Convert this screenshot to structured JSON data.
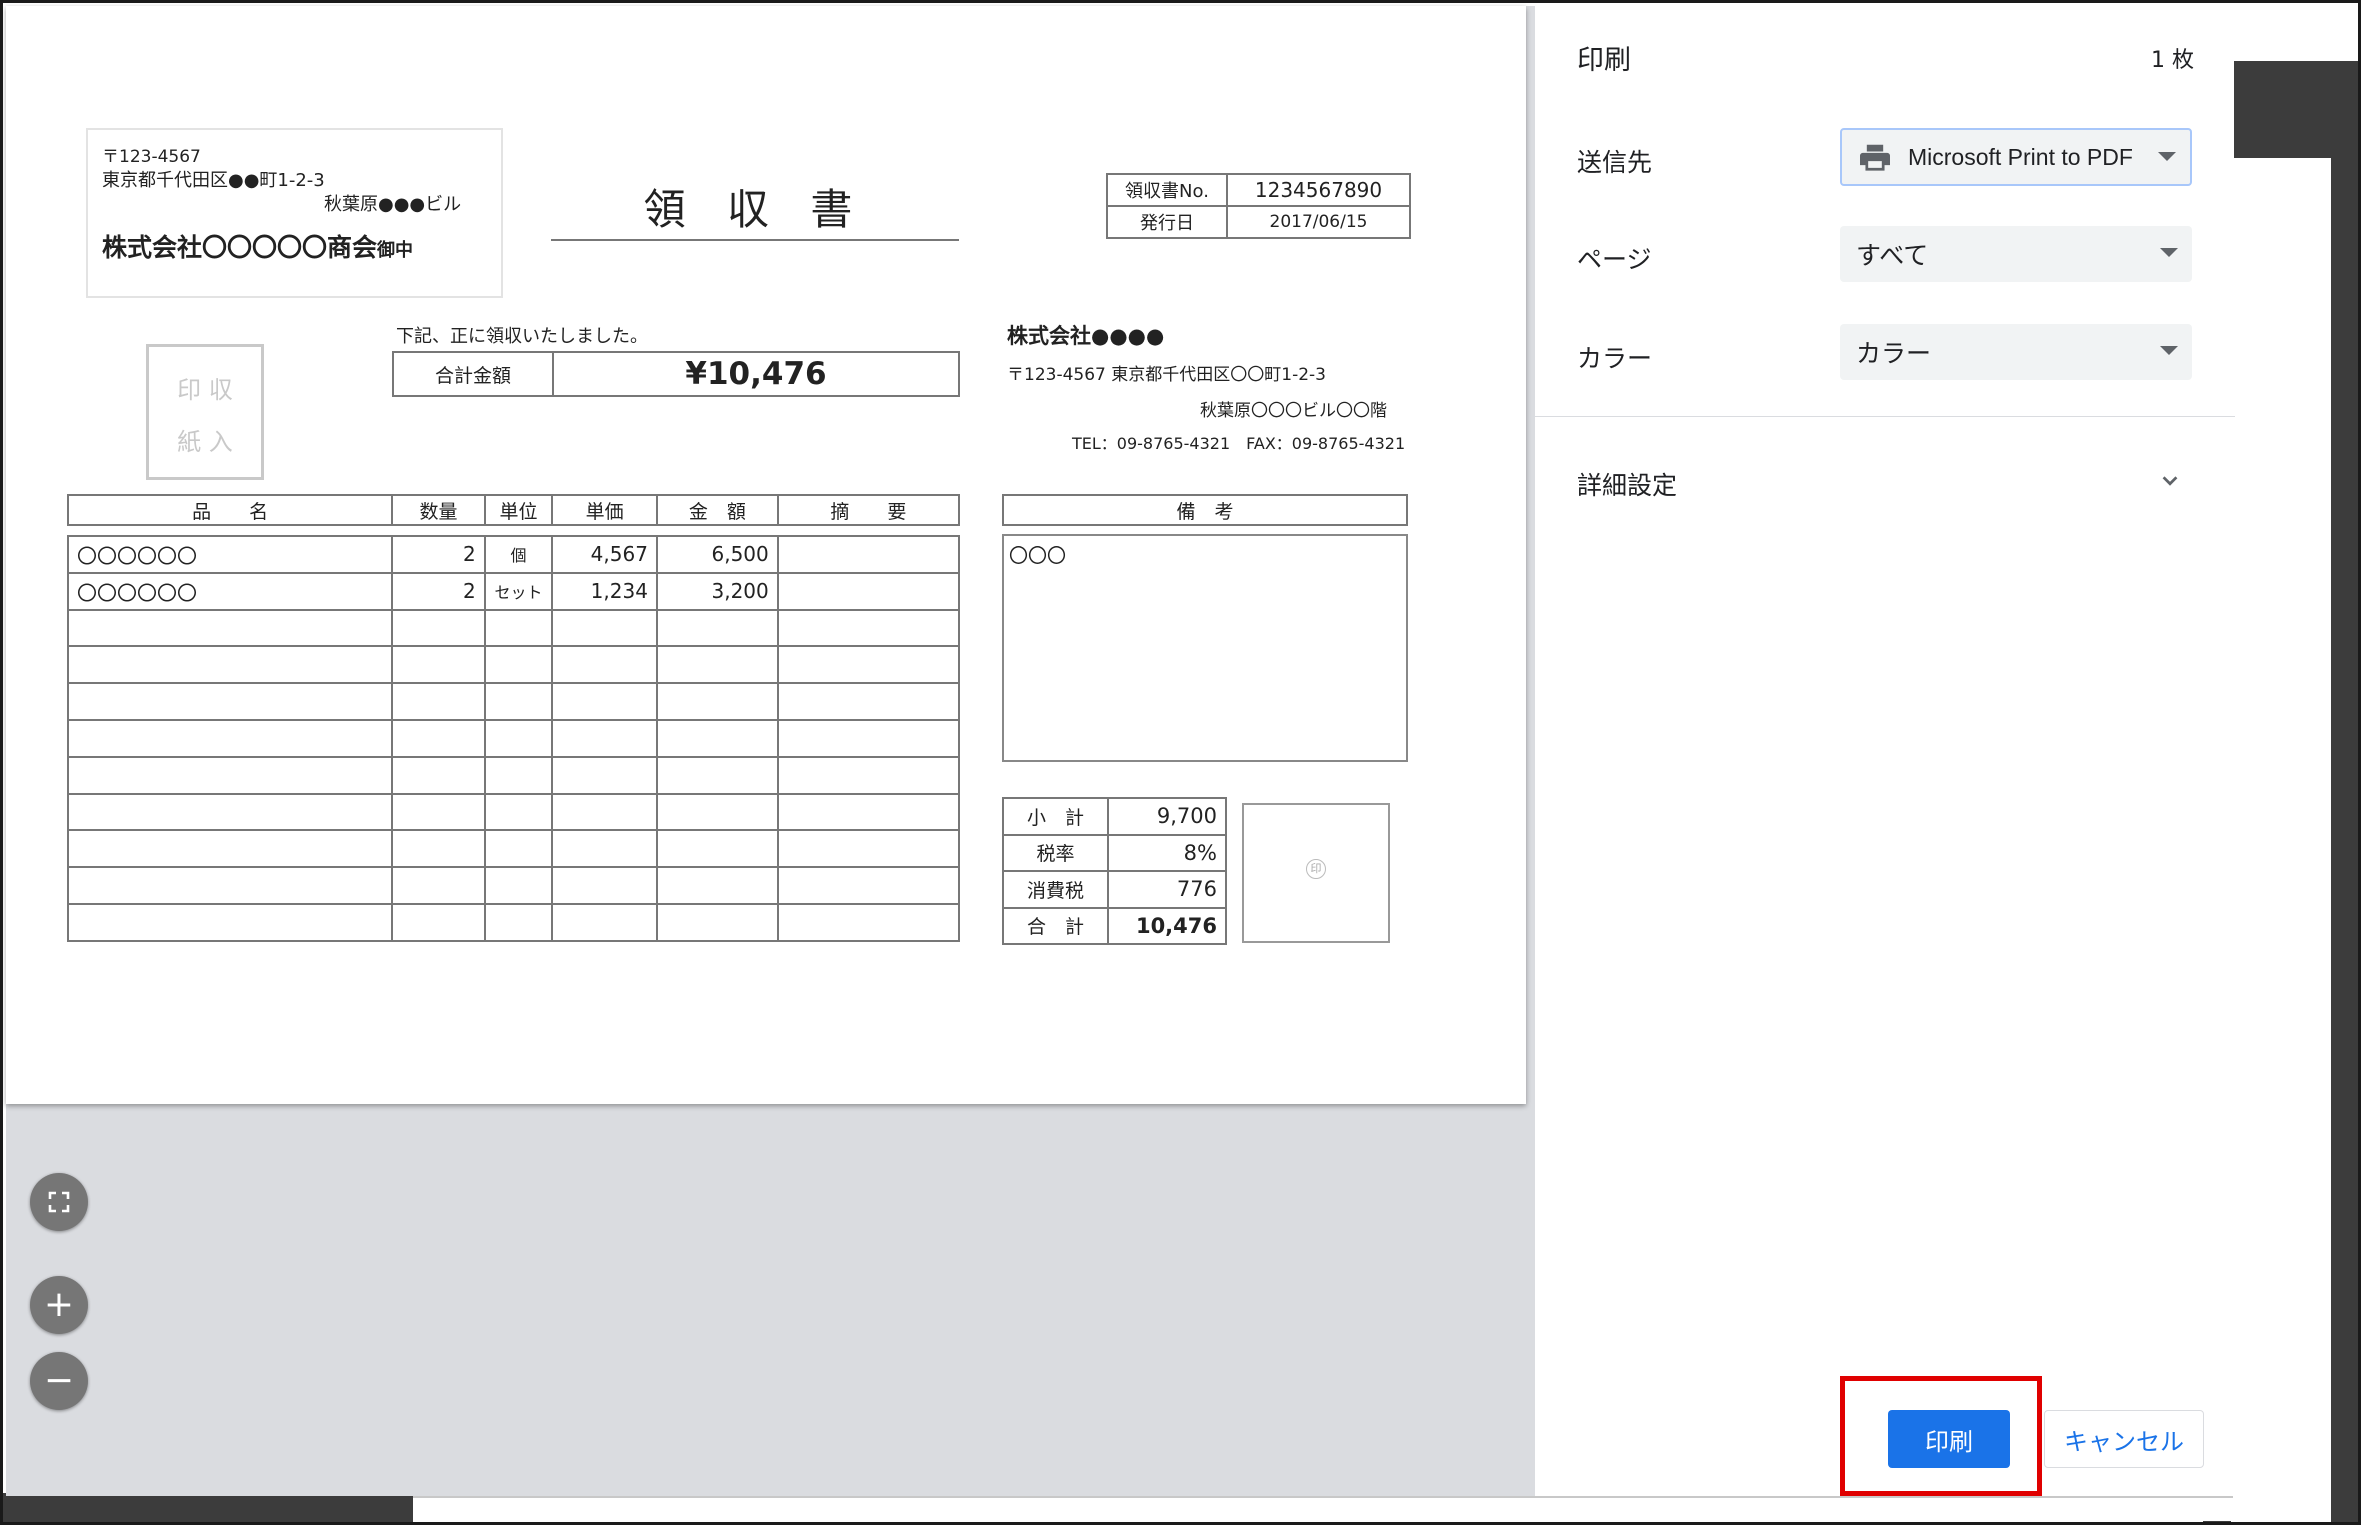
{
  "receipt": {
    "postal": "〒123-4567",
    "address1": "東京都千代田区●●町1-2-3",
    "address2": "秋葉原●●●ビル",
    "customer": "株式会社〇〇〇〇〇商会",
    "honorific": "御中",
    "title": "領 収 書",
    "receipt_no_label": "領収書No.",
    "receipt_no": "1234567890",
    "issue_date_label": "発行日",
    "issue_date": "2017/06/15",
    "stamp_line1": "印 収",
    "stamp_line2": "紙 入",
    "received_text": "下記、正に領収いたしました。",
    "total_label": "合計金額",
    "total_amount": "¥10,476",
    "issuer": {
      "company": "株式会社●●●●",
      "address": "〒123-4567 東京都千代田区〇〇町1-2-3",
      "building": "秋葉原〇〇〇ビル〇〇階",
      "tel_fax": "TEL：09-8765-4321　FAX：09-8765-4321"
    },
    "item_headers": [
      "品　　名",
      "数量",
      "単位",
      "単価",
      "金　額",
      "摘　　要"
    ],
    "items": [
      [
        "〇〇〇〇〇〇",
        "2",
        "個",
        "4,567",
        "6,500",
        ""
      ],
      [
        "〇〇〇〇〇〇",
        "2",
        "セット",
        "1,234",
        "3,200",
        ""
      ]
    ],
    "empty_rows": 9,
    "remarks_label": "備　考",
    "remarks": "〇〇〇",
    "summary": [
      {
        "label": "小　計",
        "value": "9,700"
      },
      {
        "label": "税率",
        "value": "8%"
      },
      {
        "label": "消費税",
        "value": "776"
      },
      {
        "label": "合　計",
        "value": "10,476"
      }
    ],
    "seal": "印"
  },
  "preview_controls": {
    "fit_icon": "fit-to-page-icon",
    "zoom_in": "+",
    "zoom_out": "−"
  },
  "sidebar": {
    "title": "印刷",
    "sheet_count": "1 枚",
    "destination_label": "送信先",
    "destination_value": "Microsoft Print to PDF",
    "pages_label": "ページ",
    "pages_value": "すべて",
    "color_label": "カラー",
    "color_value": "カラー",
    "advanced_label": "詳細設定",
    "print_button": "印刷",
    "cancel_button": "キャンセル"
  },
  "colors": {
    "primary_button": "#1a73e8",
    "highlight": "#e00000",
    "preview_bg": "#dadce0",
    "dark_bg": "#3c3c3c"
  }
}
